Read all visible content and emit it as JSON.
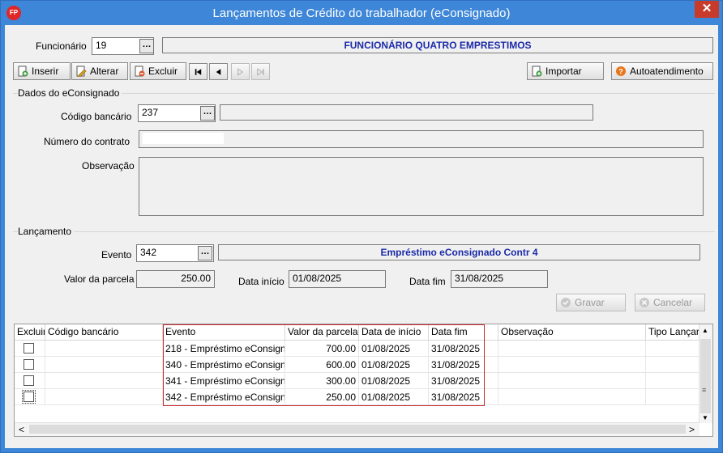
{
  "window": {
    "title": "Lançamentos de Crédito do trabalhador (eConsignado)",
    "app_icon_text": "FP",
    "close_glyph": "✕"
  },
  "funcionario": {
    "label": "Funcionário",
    "code": "19",
    "name": "FUNCIONÁRIO QUATRO EMPRESTIMOS"
  },
  "toolbar": {
    "inserir": "Inserir",
    "alterar": "Alterar",
    "excluir": "Excluir",
    "importar": "Importar",
    "autoatendimento": "Autoatendimento"
  },
  "dados": {
    "group_label": "Dados do eConsignado",
    "codigo_bancario_label": "Código bancário",
    "codigo_bancario_value": "237",
    "codigo_bancario_desc": "",
    "numero_contrato_label": "Número do contrato",
    "numero_contrato_value": "",
    "observacao_label": "Observação",
    "observacao_value": ""
  },
  "lancamento": {
    "group_label": "Lançamento",
    "evento_label": "Evento",
    "evento_code": "342",
    "evento_desc": "Empréstimo eConsignado Contr 4",
    "valor_parcela_label": "Valor da parcela",
    "valor_parcela_value": "250.00",
    "data_inicio_label": "Data início",
    "data_inicio_value": "01/08/2025",
    "data_fim_label": "Data fim",
    "data_fim_value": "31/08/2025",
    "gravar": "Gravar",
    "cancelar": "Cancelar"
  },
  "grid": {
    "columns": [
      "Excluir",
      "Código bancário",
      "Evento",
      "Valor da parcela",
      "Data de início",
      "Data fim",
      "Observação",
      "Tipo Lançar"
    ],
    "rows": [
      {
        "evento": "218 - Empréstimo eConsign",
        "valor": "700.00",
        "inicio": "01/08/2025",
        "fim": "31/08/2025"
      },
      {
        "evento": "340 - Empréstimo eConsign",
        "valor": "600.00",
        "inicio": "01/08/2025",
        "fim": "31/08/2025"
      },
      {
        "evento": "341 - Empréstimo eConsign",
        "valor": "300.00",
        "inicio": "01/08/2025",
        "fim": "31/08/2025"
      },
      {
        "evento": "342 - Empréstimo eConsign",
        "valor": "250.00",
        "inicio": "01/08/2025",
        "fim": "31/08/2025"
      }
    ]
  },
  "colors": {
    "title_bar": "#3d86d8",
    "desc_text": "#1b2aa8",
    "highlight_border": "#c8282f"
  }
}
